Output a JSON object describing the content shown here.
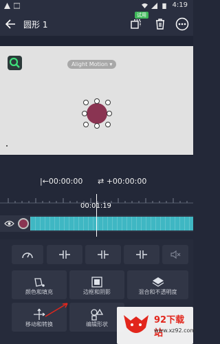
{
  "status_bar": {
    "time": "4:19",
    "icons": [
      "alert-icon",
      "image-icon",
      "wifi-icon",
      "signal-icon",
      "battery-icon"
    ]
  },
  "header": {
    "title": "圆形 1",
    "trial_badge": "试用",
    "icons": [
      "back-arrow-icon",
      "copy-icon",
      "trash-icon",
      "more-icon"
    ]
  },
  "preview": {
    "watermark_label": "Alight Motion ▾",
    "shape_color": "#8a3452"
  },
  "timeline": {
    "start_time": "|←00:00:00",
    "duration": "⇄ +00:00:00",
    "playhead_time": "00:01:19",
    "clip_color": "#3fb7c3"
  },
  "tools": {
    "row1": [
      "speedometer-icon",
      "split-left-icon",
      "split-center-icon",
      "split-right-icon",
      "mute-icon"
    ],
    "buttons": [
      {
        "label": "颜色和填充",
        "icon": "bucket-icon"
      },
      {
        "label": "边框和阴影",
        "icon": "border-icon"
      },
      {
        "label": "混合和不透明度",
        "icon": "layers-icon"
      },
      {
        "label": "移动和转换",
        "icon": "move-icon"
      },
      {
        "label": "编辑形状",
        "icon": "shapes-icon"
      }
    ]
  },
  "site_watermark": {
    "name": "92下载站",
    "url": "www.xz92.com"
  }
}
